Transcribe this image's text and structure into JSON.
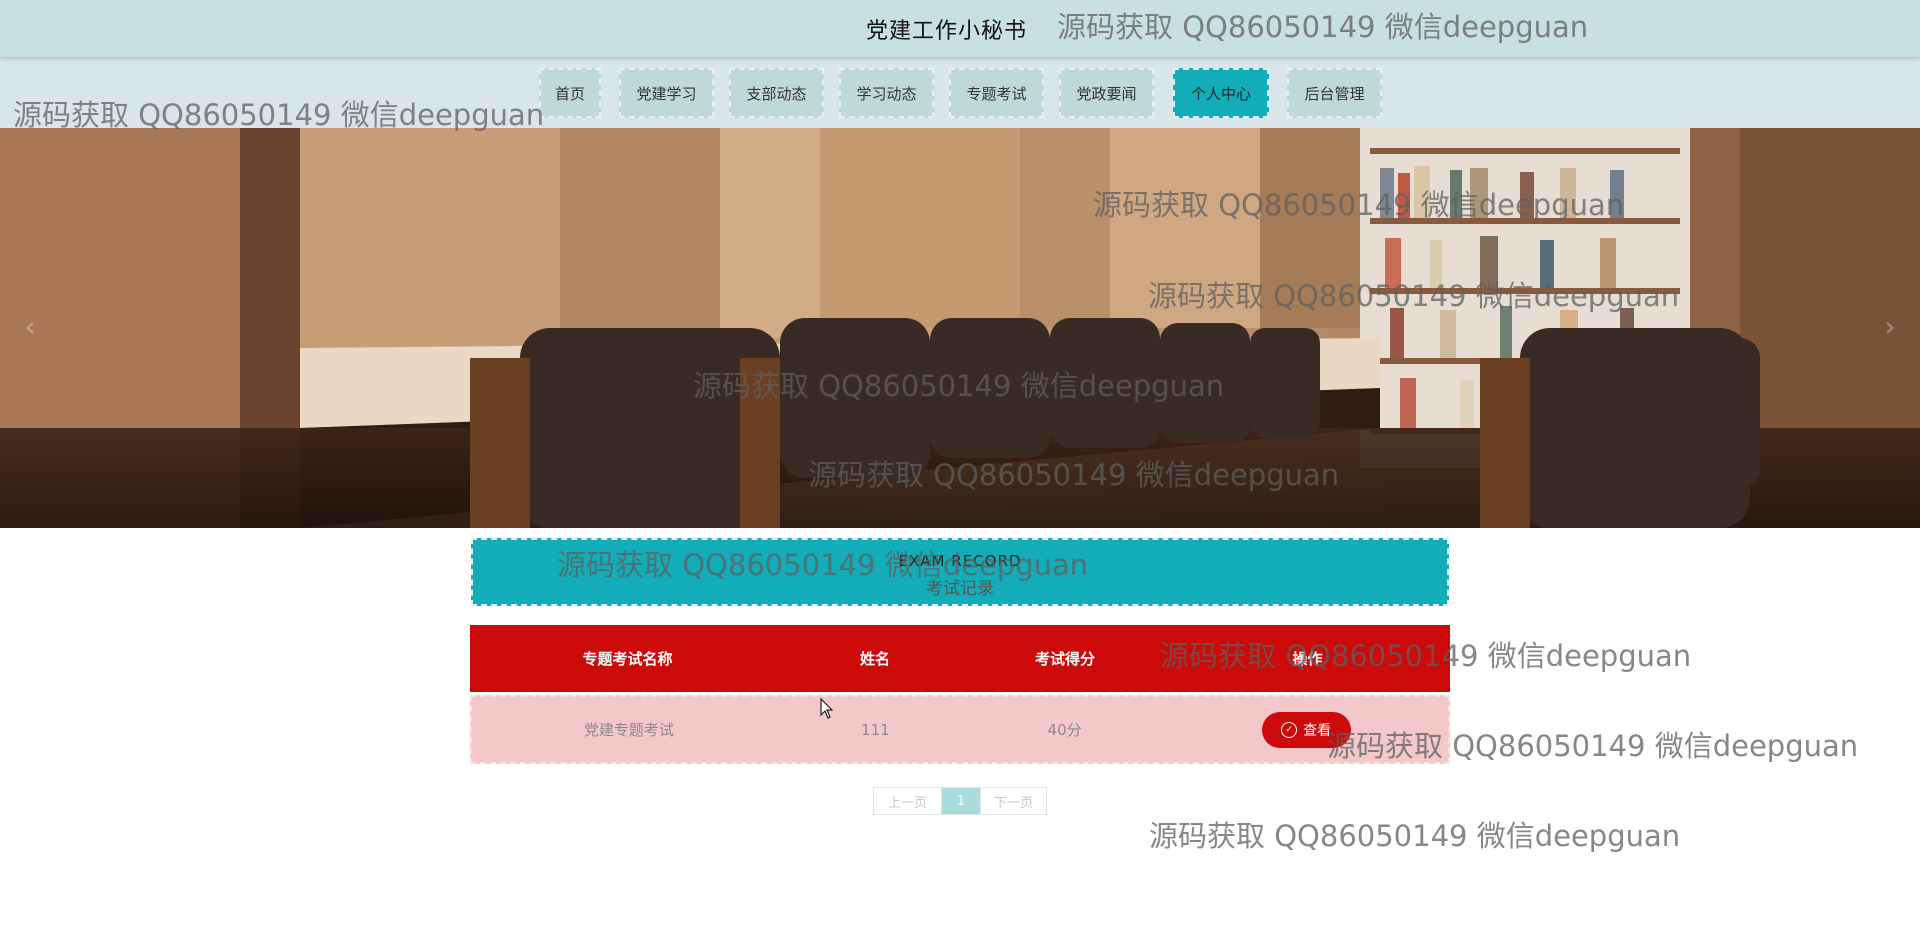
{
  "header": {
    "site_title": "党建工作小秘书"
  },
  "nav": {
    "items": [
      {
        "label": "首页",
        "active": false
      },
      {
        "label": "党建学习",
        "active": false
      },
      {
        "label": "支部动态",
        "active": false
      },
      {
        "label": "学习动态",
        "active": false
      },
      {
        "label": "专题考试",
        "active": false
      },
      {
        "label": "党政要闻",
        "active": false
      },
      {
        "label": "个人中心",
        "active": true
      },
      {
        "label": "后台管理",
        "active": false
      }
    ]
  },
  "banner": {
    "prev_icon": "chevron-left-icon",
    "next_icon": "chevron-right-icon",
    "prev_glyph": "‹",
    "next_glyph": "›"
  },
  "section": {
    "title_en": "EXAM RECORD",
    "title_cn": "考试记录"
  },
  "table": {
    "headers": [
      "专题考试名称",
      "姓名",
      "考试得分",
      "操作"
    ],
    "rows": [
      {
        "exam_name": "党建专题考试",
        "name": "111",
        "score": "40分",
        "action_label": "查看"
      }
    ]
  },
  "pagination": {
    "prev_label": "上一页",
    "current_page": "1",
    "next_label": "下一页"
  },
  "watermark": {
    "text": "源码获取 QQ86050149 微信deepguan"
  },
  "colors": {
    "header_bg": "#c9e0e2",
    "nav_bg": "#d8e6ec",
    "nav_item_bg": "#bfd9d8",
    "accent_teal": "#12adb8",
    "table_header_red": "#cc0a0a",
    "table_row_pink": "#f4c7c9"
  }
}
